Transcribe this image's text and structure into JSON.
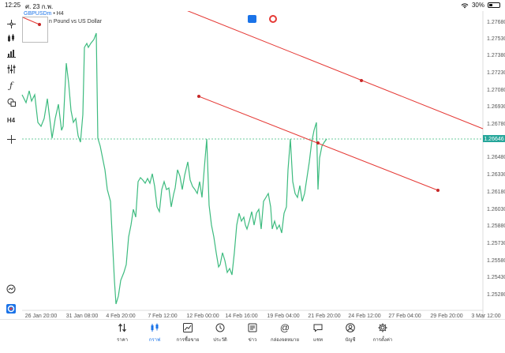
{
  "status_bar": {
    "time": "12:25",
    "date": "ศ. 23 ก.พ.",
    "battery": "30%",
    "battery_level": 0.3
  },
  "chart": {
    "symbol": "GBPUSDm",
    "timeframe_suffix": "• H4",
    "subtitle": "n Pound vs US Dollar",
    "timeframe_button": "H4",
    "current_price": "1.26646",
    "price_labels": [
      "1.27680",
      "1.27530",
      "1.27380",
      "1.27230",
      "1.27080",
      "1.26930",
      "1.26780",
      "1.26480",
      "1.26330",
      "1.26180",
      "1.26030",
      "1.25880",
      "1.25730",
      "1.25580",
      "1.25430",
      "1.25280"
    ],
    "time_labels": [
      "26 Jan 20:00",
      "31 Jan 08:00",
      "4 Feb 20:00",
      "7 Feb 12:00",
      "12 Feb 00:00",
      "14 Feb 16:00",
      "19 Feb 04:00",
      "21 Feb 20:00",
      "24 Feb 12:00",
      "27 Feb 04:00",
      "29 Feb 20:00",
      "3 Mar 12:00"
    ],
    "colors": {
      "price_line": "#3dbb7f",
      "trend_line": "#e53935",
      "axis_text": "#555555",
      "current_price_bg": "#26a69a"
    }
  },
  "left_toolbar": {
    "icons": [
      "crosshair-icon",
      "candles-icon",
      "bars-icon",
      "indicators-icon",
      "function-icon",
      "objects-icon",
      "timeframe-h4",
      "crosshair-bottom-icon"
    ]
  },
  "tabs": [
    {
      "label": "ราคา",
      "icon": "quotes-icon"
    },
    {
      "label": "กราฟ",
      "icon": "chart-icon",
      "active": true
    },
    {
      "label": "การซื้อขาย",
      "icon": "trade-icon"
    },
    {
      "label": "ประวัติ",
      "icon": "history-icon"
    },
    {
      "label": "ข่าว",
      "icon": "news-icon"
    },
    {
      "label": "กล่องจดหมาย",
      "icon": "mailbox-icon"
    },
    {
      "label": "แชท",
      "icon": "chat-icon"
    },
    {
      "label": "บัญชี",
      "icon": "account-icon"
    },
    {
      "label": "การตั้งค่า",
      "icon": "settings-icon"
    }
  ]
}
